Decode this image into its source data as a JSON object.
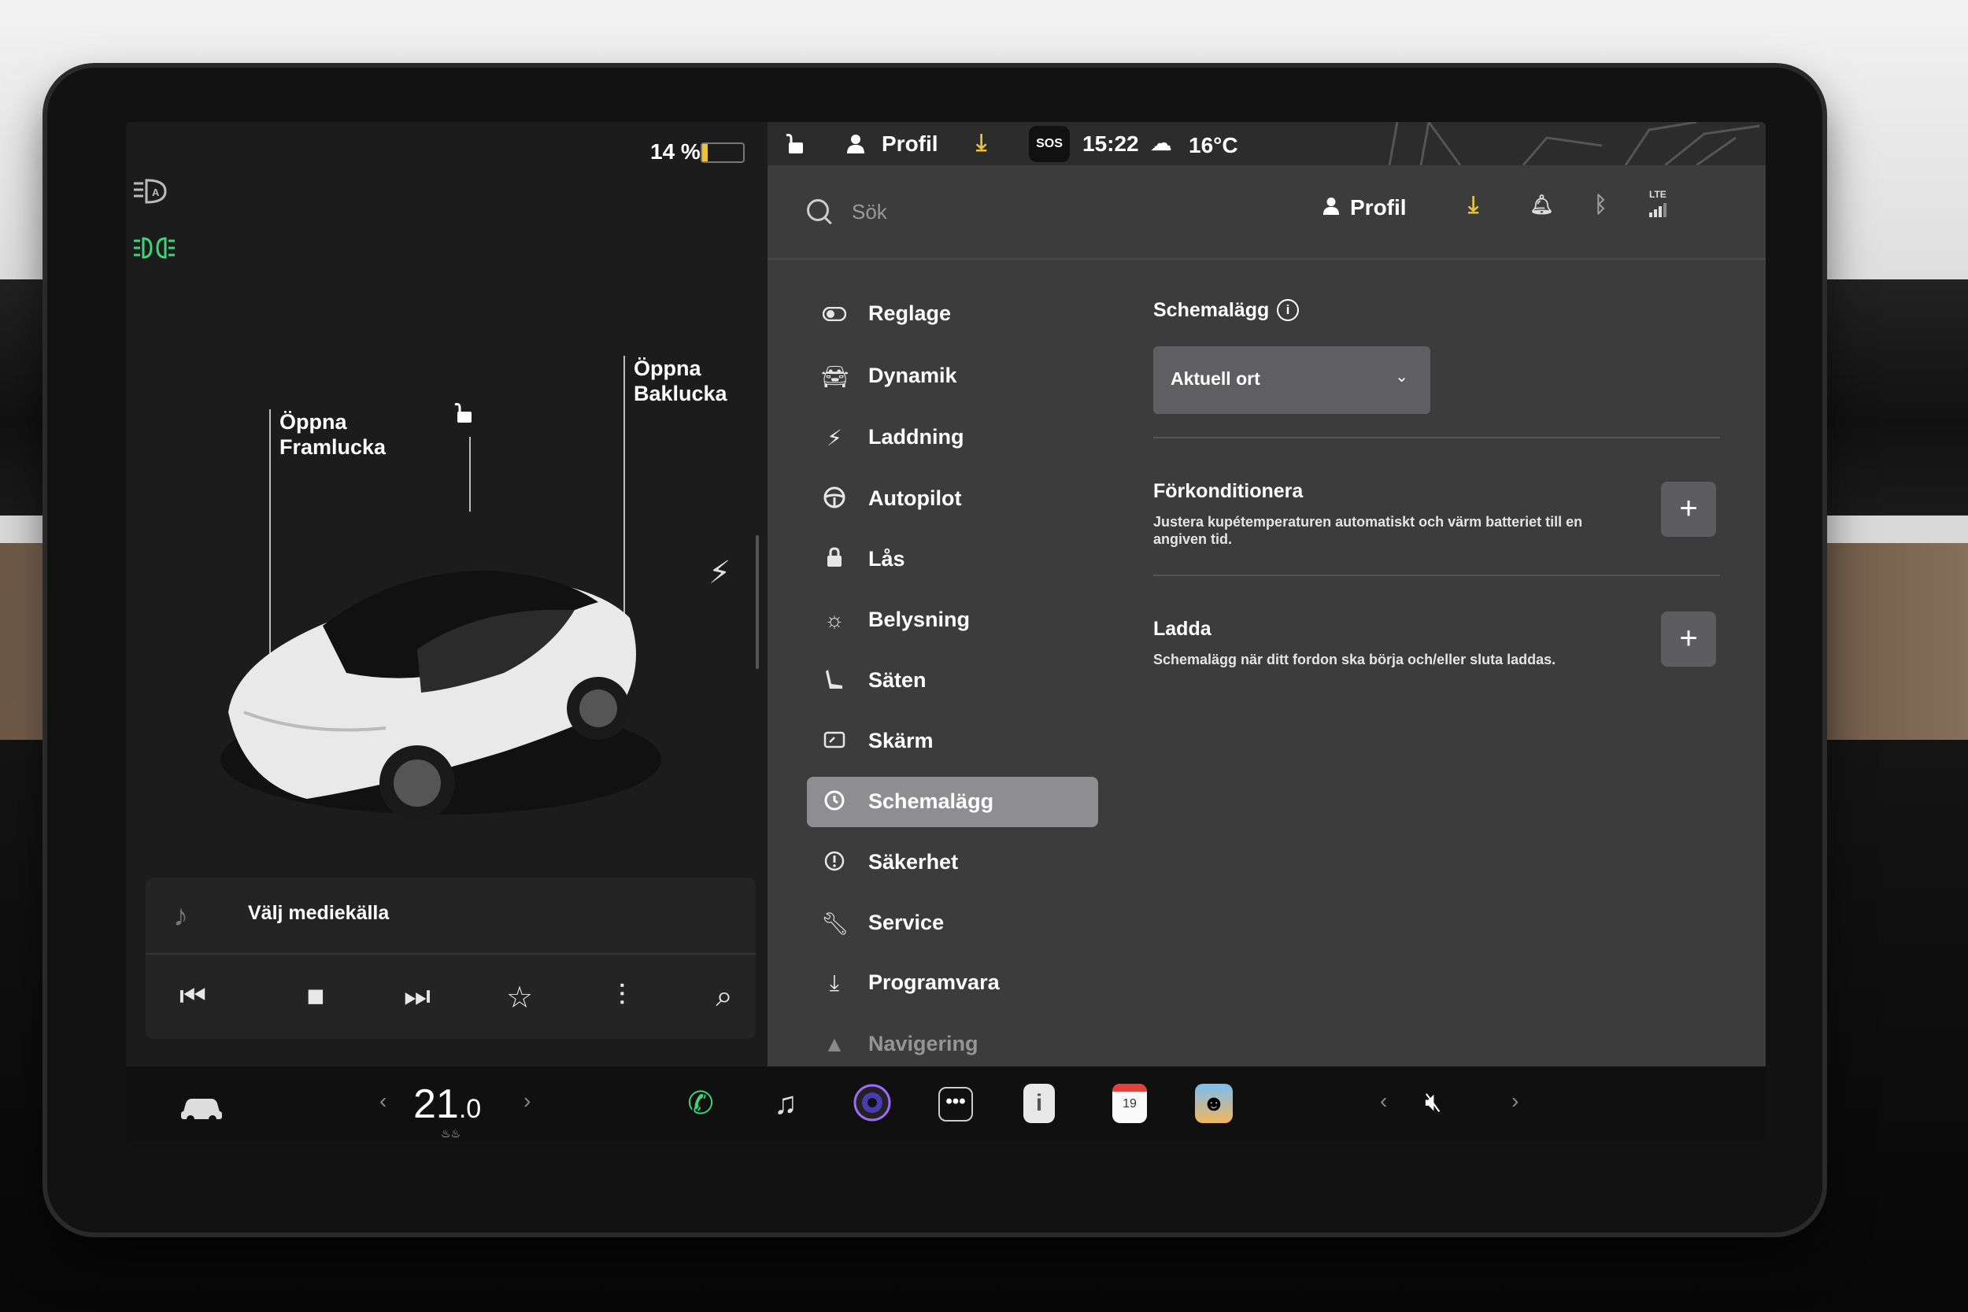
{
  "car_panel": {
    "battery_percent": "14 %",
    "battery_level": 0.14,
    "label_front": "Öppna\nFramlucka",
    "label_front_line1": "Öppna",
    "label_front_line2": "Framlucka",
    "label_rear_line1": "Öppna",
    "label_rear_line2": "Baklucka"
  },
  "media": {
    "source_label": "Välj mediekälla"
  },
  "status_bar": {
    "profile": "Profil",
    "sos": "SOS",
    "time": "15:22",
    "temperature": "16°C"
  },
  "settings": {
    "search_placeholder": "Sök",
    "profile": "Profil",
    "lte": "LTE",
    "menu": [
      {
        "label": "Reglage",
        "icon": "toggle-icon"
      },
      {
        "label": "Dynamik",
        "icon": "car-icon"
      },
      {
        "label": "Laddning",
        "icon": "bolt-icon"
      },
      {
        "label": "Autopilot",
        "icon": "steering-wheel-icon"
      },
      {
        "label": "Lås",
        "icon": "lock-icon"
      },
      {
        "label": "Belysning",
        "icon": "sun-icon"
      },
      {
        "label": "Säten",
        "icon": "seat-icon"
      },
      {
        "label": "Skärm",
        "icon": "display-icon"
      },
      {
        "label": "Schemalägg",
        "icon": "clock-icon",
        "active": true
      },
      {
        "label": "Säkerhet",
        "icon": "alert-icon"
      },
      {
        "label": "Service",
        "icon": "wrench-icon"
      },
      {
        "label": "Programvara",
        "icon": "download-icon"
      },
      {
        "label": "Navigering",
        "icon": "navigation-icon"
      }
    ],
    "content": {
      "title": "Schemalägg",
      "dropdown_value": "Aktuell ort",
      "precondition_title": "Förkonditionera",
      "precondition_desc": "Justera kupétemperaturen automatiskt och värm batteriet till en angiven tid.",
      "charge_title": "Ladda",
      "charge_desc": "Schemalägg när ditt fordon ska börja och/eller sluta laddas."
    }
  },
  "bottom_bar": {
    "temp_whole": "21",
    "temp_decimal": ".0",
    "calendar_day": "19"
  },
  "colors": {
    "accent_green": "#3fd37a",
    "download_yellow": "#e9c23b",
    "settings_bg": "#3c3c3d",
    "active_menu": "#8e8e90"
  }
}
